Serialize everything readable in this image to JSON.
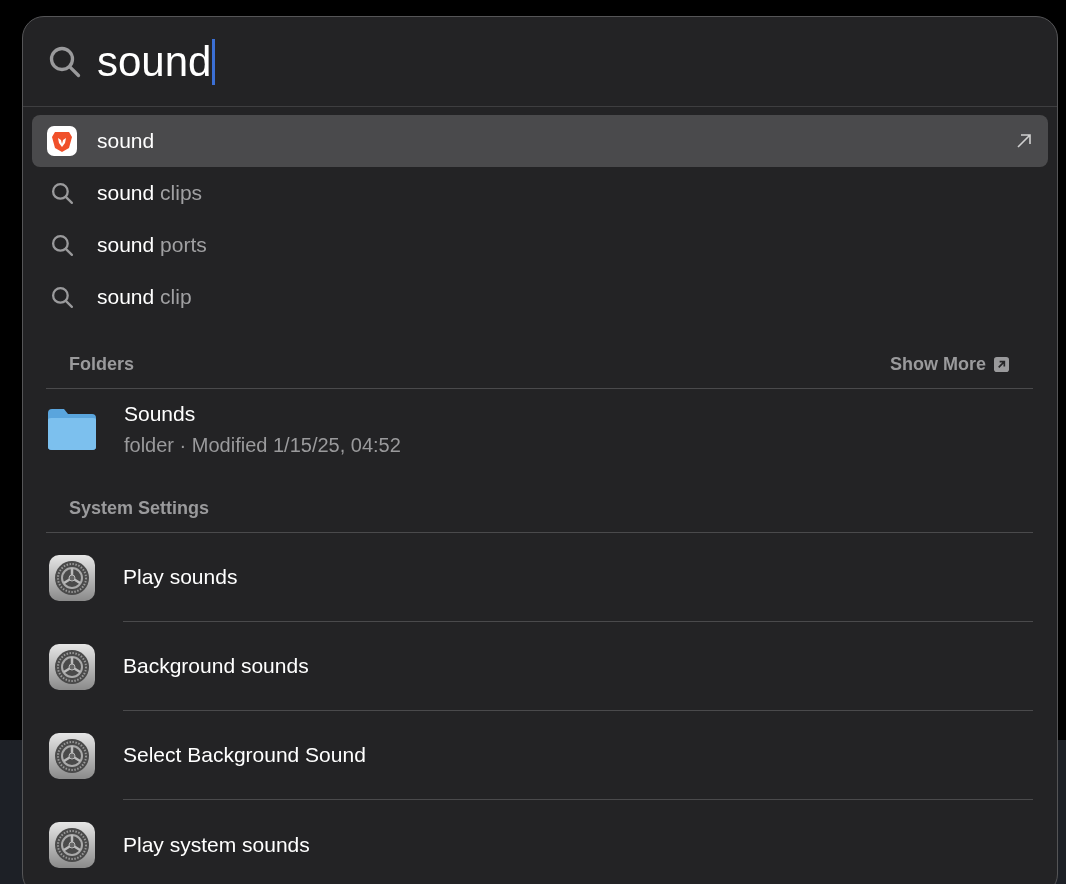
{
  "search": {
    "value": "sound"
  },
  "suggestions": [
    {
      "kind": "app",
      "typed": "sound",
      "selected": true
    },
    {
      "kind": "web",
      "typed": "sound",
      "completion": "clips",
      "selected": false
    },
    {
      "kind": "web",
      "typed": "sound",
      "completion": "ports",
      "selected": false
    },
    {
      "kind": "web",
      "typed": "sound",
      "completion": "clip",
      "selected": false
    }
  ],
  "folders": {
    "title": "Folders",
    "action": "Show More",
    "items": [
      {
        "name": "Sounds",
        "detail": "folder · Modified 1/15/25, 04:52"
      }
    ]
  },
  "system_settings": {
    "title": "System Settings",
    "items": [
      {
        "name": "Play sounds"
      },
      {
        "name": "Background sounds"
      },
      {
        "name": "Select Background Sound"
      },
      {
        "name": "Play system sounds"
      }
    ]
  }
}
